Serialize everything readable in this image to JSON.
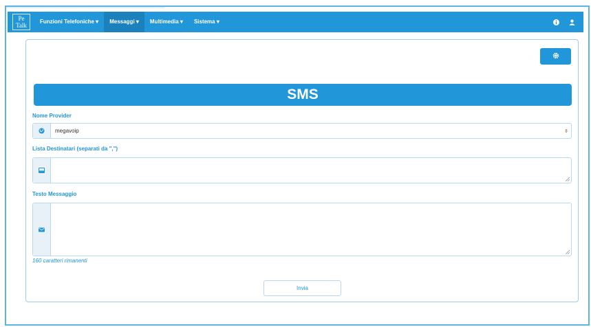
{
  "colors": {
    "primary": "#2196d8",
    "active_nav": "#1a81bd",
    "border": "#b9d9ee",
    "addon_bg": "#e8f1f8"
  },
  "logo": {
    "line1": "Pe",
    "line2": "Talk"
  },
  "navbar": {
    "items": [
      {
        "label": "Funzioni Telefoniche ▾",
        "active": false
      },
      {
        "label": "Messaggi ▾",
        "active": true
      },
      {
        "label": "Multimedia ▾",
        "active": false
      },
      {
        "label": "Sistema ▾",
        "active": false
      }
    ],
    "right_icons": [
      "info-icon",
      "user-icon"
    ]
  },
  "settings_button": {
    "icon": "gear-icon"
  },
  "page": {
    "title": "SMS",
    "provider": {
      "label": "Nome Provider",
      "value": "megavoip",
      "icon": "globe-icon"
    },
    "recipients": {
      "label": "Lista Destinatari (separati da \",\")",
      "value": "",
      "icon": "inbox-icon"
    },
    "message": {
      "label": "Testo Messaggio",
      "value": "",
      "icon": "envelope-icon"
    },
    "remaining_text": "160 caratteri rimanenti",
    "send_label": "Invia"
  }
}
